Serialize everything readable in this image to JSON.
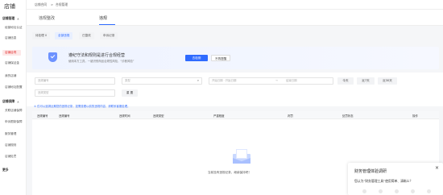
{
  "app": {
    "logo": "店铺"
  },
  "sidebar": {
    "groups": [
      {
        "label": "店铺管理",
        "items": [
          "经营地址认证",
          "店铺信息",
          "店铺合同",
          "店铺保证金",
          "我的店铺",
          "店铺地址配置"
        ]
      },
      {
        "label": "店铺保障",
        "items": [
          "关联店铺保障",
          "申诉限制保障",
          "服务管理",
          "店铺规则",
          "店铺处罚"
        ]
      },
      {
        "label": "更多",
        "items": []
      }
    ],
    "active_item": "店铺合同"
  },
  "breadcrumb": {
    "parent": "店铺合同",
    "separator": ">",
    "current": "合规管理"
  },
  "tabs": {
    "items": [
      "违规整改",
      "违规"
    ],
    "active": "违规"
  },
  "subtabs": {
    "items": [
      "待处理 0",
      "全部违规",
      "已整改",
      "申诉记录"
    ],
    "active": "全部违规"
  },
  "banner": {
    "title": "遵纪守法和规则是进行合规经营",
    "subtitle": "使用本方工具，一键识别商品合规性风险，“诊断风险”",
    "primary_btn": "去检测",
    "ghost_btn": "不再提醒"
  },
  "filters": {
    "f1_placeholder": "违规编号",
    "f2_placeholder": "类型",
    "date_start": "开始日期 · 开始日期",
    "date_sep": "→",
    "date_end": "结束日期",
    "f4_placeholder": "违规类型",
    "btn_reset": "重 置",
    "btn_day": "今天",
    "btn_week": "近7天",
    "btn_month": "近30天"
  },
  "notice": "① 仅可以追溯近期您的违规记录，如需查看以前的违规内容，请联系客服处理。",
  "table": {
    "columns": [
      "违规编号",
      "违规编号",
      "违规时间",
      "违规类型",
      "严重程度",
      "判罚",
      "处罚状态",
      "操作"
    ],
    "empty_text": "当前没有违规记录，继续保持吧！"
  },
  "survey": {
    "title": "财务管理体验调研",
    "question": "您认为“财务管理工具”使用简单、清晰么？",
    "close": "×"
  }
}
